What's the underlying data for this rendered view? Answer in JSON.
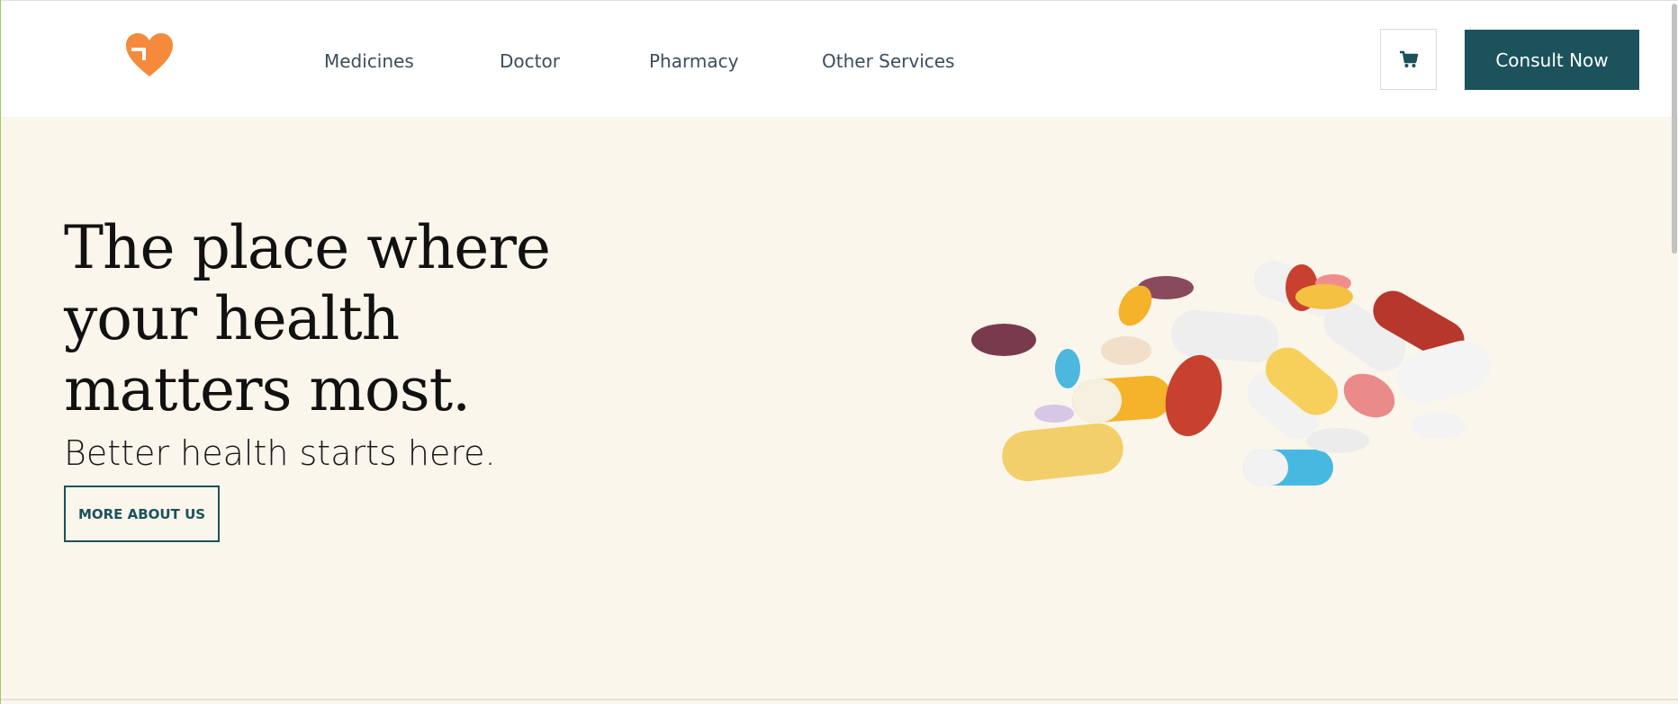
{
  "brand": {
    "logo_icon": "heart-logo-icon",
    "accent": "#f58a3c"
  },
  "nav": {
    "items": [
      {
        "label": "Medicines"
      },
      {
        "label": "Doctor"
      },
      {
        "label": "Pharmacy"
      },
      {
        "label": "Other Services"
      }
    ]
  },
  "header": {
    "cart_icon": "shopping-cart-icon",
    "consult_label": "Consult Now",
    "primary_color": "#1b525c"
  },
  "hero": {
    "title": "The place where your health matters most.",
    "subtitle": "Better health starts here.",
    "cta_label": "MORE ABOUT US",
    "background": "#faf6ec"
  }
}
